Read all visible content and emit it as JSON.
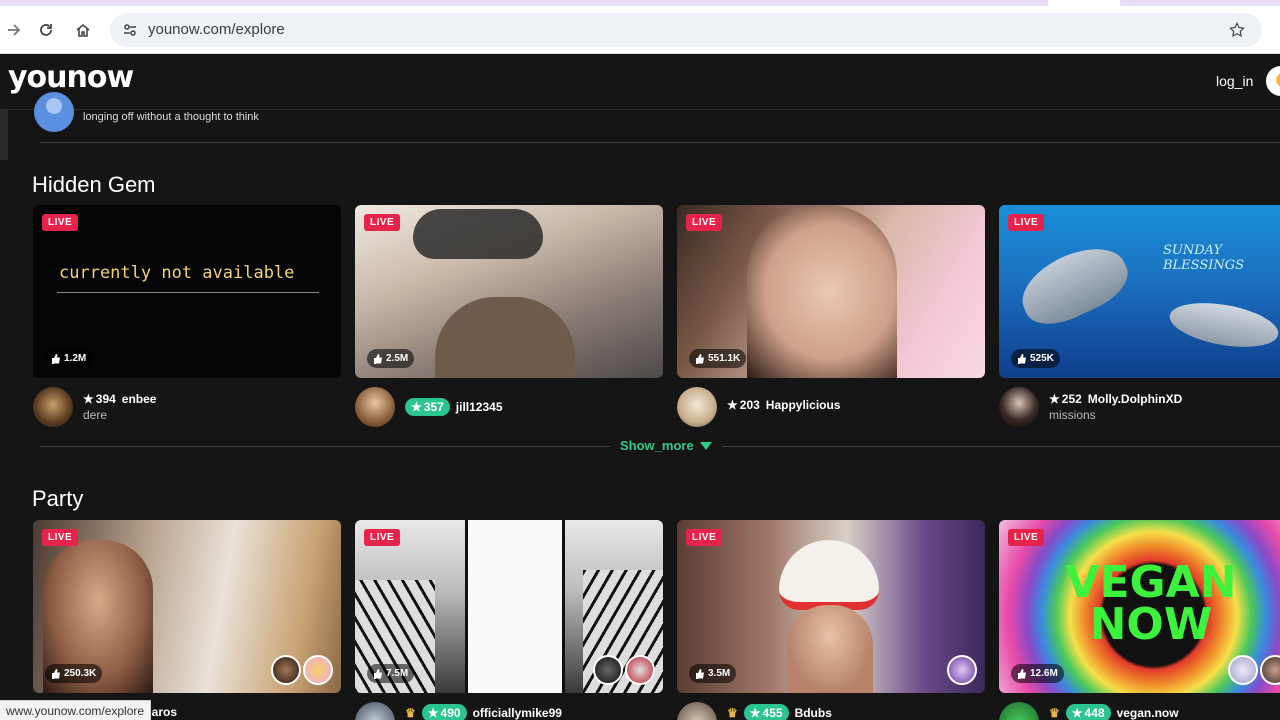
{
  "browser": {
    "url": "younow.com/explore",
    "status_url": "www.younow.com/explore"
  },
  "header": {
    "logo": "younow",
    "login": "log_in"
  },
  "previous_row": {
    "text": "longing off without a thought to think"
  },
  "sections": [
    {
      "title": "Hidden Gem",
      "cards": [
        {
          "live": "LIVE",
          "likes": "1.2M",
          "rank": "394",
          "rank_pill": false,
          "name": "enbee",
          "sub": "dere",
          "thumb_text": "currently not available"
        },
        {
          "live": "LIVE",
          "likes": "2.5M",
          "rank": "357",
          "rank_pill": true,
          "name": "jill12345",
          "sub": ""
        },
        {
          "live": "LIVE",
          "likes": "551.1K",
          "rank": "203",
          "rank_pill": false,
          "name": "Happylicious",
          "sub": ""
        },
        {
          "live": "LIVE",
          "likes": "525K",
          "rank": "252",
          "rank_pill": false,
          "name": "Molly.DolphinXD",
          "sub": "missions",
          "thumb_text": "SUNDAY BLESSINGS"
        }
      ]
    },
    {
      "title": "Party",
      "cards": [
        {
          "live": "LIVE",
          "likes": "250.3K",
          "name": "saros"
        },
        {
          "live": "LIVE",
          "likes": "7.5M",
          "rank": "490",
          "name": "officiallymike99"
        },
        {
          "live": "LIVE",
          "likes": "3.5M",
          "rank": "455",
          "name": "Bdubs"
        },
        {
          "live": "LIVE",
          "likes": "12.6M",
          "rank": "448",
          "name": "vegan.now",
          "thumb_text_1": "VEGAN",
          "thumb_text_2": "NOW"
        }
      ]
    }
  ],
  "show_more": "Show_more",
  "colors": {
    "live": "#e6234b",
    "accent_green": "#2cc48f",
    "show_more": "#35c98b",
    "background": "#151515"
  }
}
